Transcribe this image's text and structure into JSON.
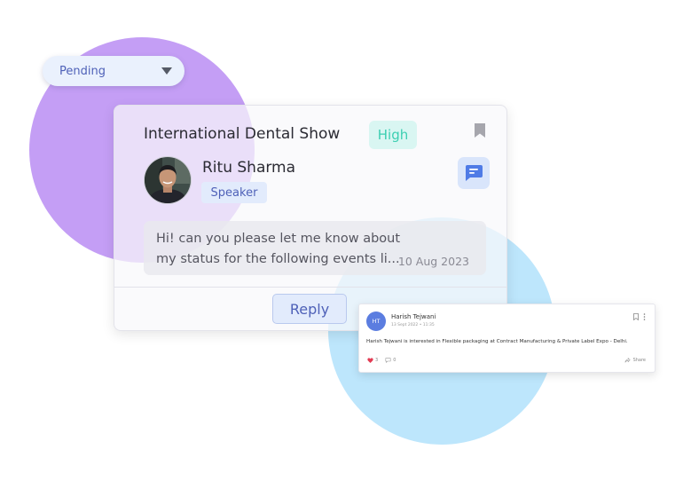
{
  "status_dropdown": {
    "selected": "Pending"
  },
  "event_card": {
    "title": "International Dental Show",
    "priority": "High",
    "person_name": "Ritu Sharma",
    "person_role": "Speaker",
    "message": "Hi! can you please let me know about my status for the following events li...",
    "message_date": "10 Aug 2023",
    "reply_label": "Reply"
  },
  "notification": {
    "initials": "HT",
    "name": "Harish Tejwani",
    "time": "13 Sept 2022 • 11:35",
    "body": "Harish Tejwani is interested in Flexible packaging at Contract Manufacturing & Private Label Expo - Delhi.",
    "likes": "3",
    "comments": "0",
    "share_label": "Share"
  },
  "colors": {
    "accent": "#4f61b8",
    "priority_high": "#3ccfb2",
    "purple_blob": "#c49ef5",
    "blue_blob": "#bde6fc"
  },
  "icons": [
    "chevron-down-icon",
    "bookmark-icon",
    "chat-icon",
    "more-vertical-icon",
    "heart-icon",
    "comment-icon",
    "share-icon"
  ]
}
